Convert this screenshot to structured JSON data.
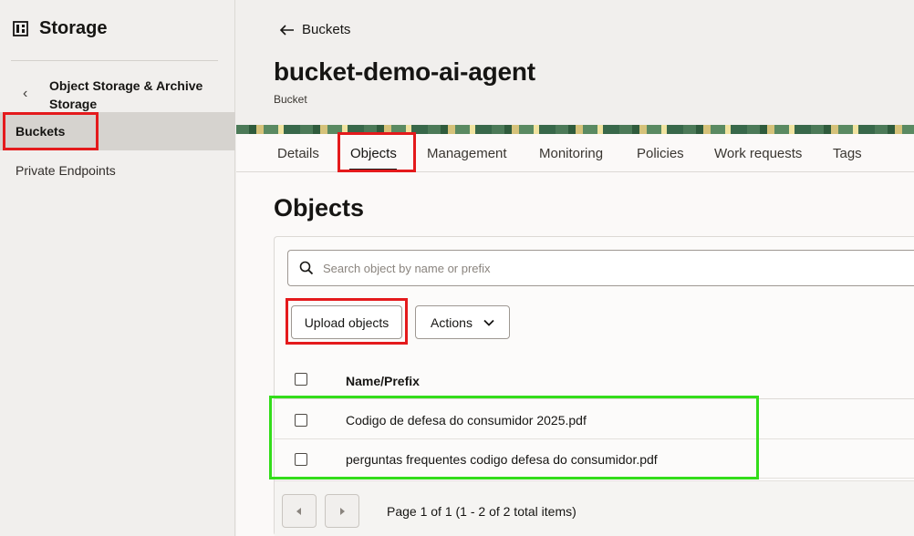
{
  "sidebar": {
    "title": "Storage",
    "section": "Object Storage & Archive Storage",
    "back_glyph": "‹",
    "items": [
      {
        "label": "Buckets",
        "active": true
      },
      {
        "label": "Private Endpoints",
        "active": false
      }
    ]
  },
  "header": {
    "back_label": "Buckets",
    "title": "bucket-demo-ai-agent",
    "subtitle": "Bucket"
  },
  "tabs": [
    {
      "label": "Details"
    },
    {
      "label": "Objects",
      "active": true
    },
    {
      "label": "Management"
    },
    {
      "label": "Monitoring"
    },
    {
      "label": "Policies"
    },
    {
      "label": "Work requests"
    },
    {
      "label": "Tags"
    }
  ],
  "objects": {
    "title": "Objects",
    "search_placeholder": "Search object by name or prefix",
    "upload_label": "Upload objects",
    "actions_label": "Actions",
    "column_name": "Name/Prefix",
    "rows": [
      {
        "name": "Codigo de defesa do consumidor 2025.pdf"
      },
      {
        "name": "perguntas frequentes codigo defesa do consumidor.pdf"
      }
    ],
    "pagination": "Page 1 of 1 (1 - 2 of 2 total items)"
  },
  "colors": {
    "highlight_red": "#e41a1c",
    "highlight_green": "#33dd1a"
  }
}
